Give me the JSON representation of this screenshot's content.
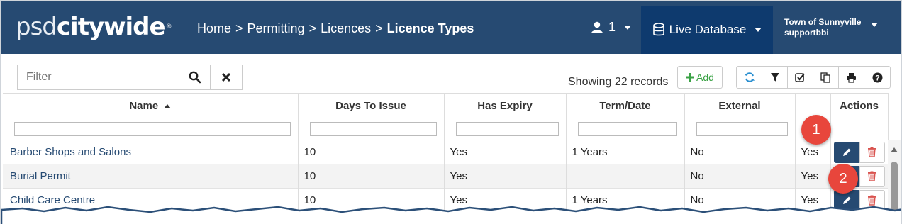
{
  "header": {
    "logo_lite": "psd",
    "logo_bold": "citywide",
    "logo_mark": "®",
    "breadcrumb": [
      "Home",
      "Permitting",
      "Licences",
      "Licence Types"
    ],
    "breadcrumb_sep": ">",
    "user_count": "1",
    "database_label": "Live Database",
    "town": "Town of Sunnyville",
    "username": "supportbbi"
  },
  "toolbar": {
    "filter_placeholder": "Filter",
    "showing_text": "Showing 22 records",
    "add_label": "Add",
    "icons": [
      "refresh-icon",
      "filter-icon",
      "check-square-icon",
      "copy-icon",
      "print-icon",
      "help-icon"
    ]
  },
  "grid": {
    "columns": [
      "Name",
      "Days To Issue",
      "Has Expiry",
      "Term/Date",
      "External",
      "",
      "Actions"
    ],
    "rows": [
      {
        "name": "Barber Shops and Salons",
        "days": "10",
        "expiry": "Yes",
        "term": "1 Years",
        "external": "No",
        "extra": "Yes"
      },
      {
        "name": "Burial Permit",
        "days": "10",
        "expiry": "Yes",
        "term": "",
        "external": "No",
        "extra": "Yes"
      },
      {
        "name": "Child Care Centre",
        "days": "10",
        "expiry": "Yes",
        "term": "1 Years",
        "external": "No",
        "extra": "Yes"
      }
    ]
  },
  "callouts": [
    "1",
    "2"
  ],
  "colors": {
    "header_bg": "#264a72",
    "database_bg": "#0e3a6e",
    "edit_btn": "#264a72",
    "delete_icon": "#d9534f",
    "add_green": "#3aa245",
    "callout": "#e8463c"
  }
}
